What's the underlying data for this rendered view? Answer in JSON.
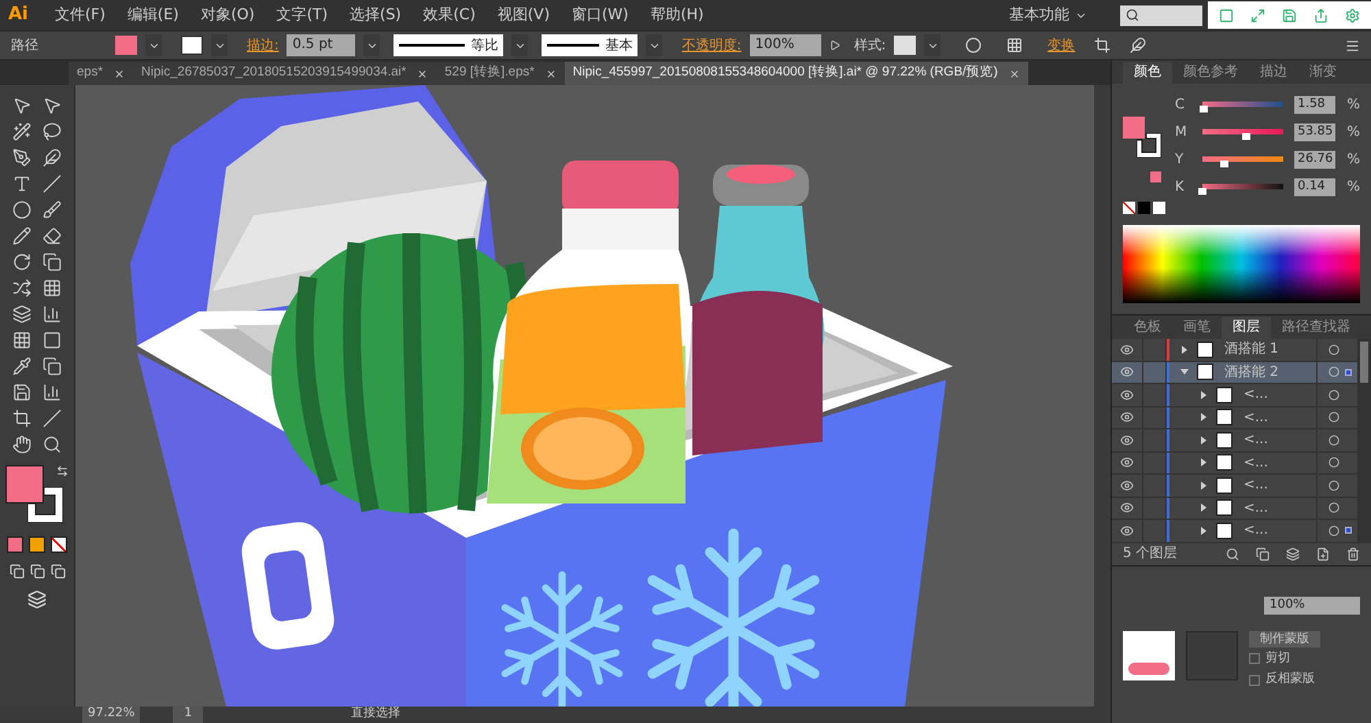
{
  "menu_bar": {
    "logo": "Ai",
    "menus": [
      "文件(F)",
      "编辑(E)",
      "对象(O)",
      "文字(T)",
      "选择(S)",
      "效果(C)",
      "视图(V)",
      "窗口(W)",
      "帮助(H)"
    ],
    "workspace": "基本功能"
  },
  "control_bar": {
    "object_type": "路径",
    "stroke_label": "描边:",
    "stroke_weight": "0.5 pt",
    "profile": "等比",
    "brush": "基本",
    "opacity_label": "不透明度:",
    "opacity": "100%",
    "style_label": "样式:",
    "transform_link": "变换"
  },
  "doc_tabs": [
    {
      "label": "eps*",
      "selected": false
    },
    {
      "label": "Nipic_26785037_20180515203915499034.ai*",
      "selected": false
    },
    {
      "label": "529 [转换].eps*",
      "selected": false
    },
    {
      "label": "Nipic_455997_20150808155348604000 [转换].ai* @ 97.22% (RGB/预览)",
      "selected": true
    }
  ],
  "color_panel": {
    "tabs": [
      {
        "label": "颜色",
        "selected": true
      },
      {
        "label": "颜色参考",
        "selected": false
      },
      {
        "label": "描边",
        "selected": false
      },
      {
        "label": "渐变",
        "selected": false
      }
    ],
    "channels": [
      {
        "name": "C",
        "value": "1.58",
        "unit": "%",
        "level": 0.016
      },
      {
        "name": "M",
        "value": "53.85",
        "unit": "%",
        "level": 0.54
      },
      {
        "name": "Y",
        "value": "26.76",
        "unit": "%",
        "level": 0.27
      },
      {
        "name": "K",
        "value": "0.14",
        "unit": "%",
        "level": 0.0014
      }
    ]
  },
  "layers_panel": {
    "tabs": [
      {
        "label": "色板",
        "selected": false
      },
      {
        "label": "画笔",
        "selected": false
      },
      {
        "label": "图层",
        "selected": true
      },
      {
        "label": "路径查找器",
        "selected": false
      }
    ],
    "layers": [
      {
        "name": "酒搭能 1",
        "color": "#e03a3a",
        "expanded": false,
        "selected": false,
        "targeted": false
      },
      {
        "name": "酒搭能 2",
        "color": "#3d6fe0",
        "expanded": true,
        "selected": true,
        "targeted": true,
        "children": [
          {
            "name": "<...",
            "expanded": false,
            "selected": false,
            "targeted": false
          },
          {
            "name": "<...",
            "expanded": false,
            "selected": false,
            "targeted": false
          },
          {
            "name": "<...",
            "expanded": false,
            "selected": false,
            "targeted": false
          },
          {
            "name": "<...",
            "expanded": false,
            "selected": false,
            "targeted": false
          },
          {
            "name": "<...",
            "expanded": false,
            "selected": false,
            "targeted": false
          },
          {
            "name": "<...",
            "expanded": false,
            "selected": false,
            "targeted": false
          },
          {
            "name": "<...",
            "expanded": false,
            "selected": false,
            "targeted": true
          }
        ]
      }
    ],
    "count": "5 个图层"
  },
  "transparency_panel": {
    "opacity": "100%",
    "make_mask": "制作蒙版",
    "options": [
      {
        "label": "剪切",
        "checked": false
      },
      {
        "label": "反相蒙版",
        "checked": false
      }
    ]
  },
  "status_bar": {
    "zoom": "97.22%",
    "artboard": "1",
    "tool": "直接选择"
  }
}
